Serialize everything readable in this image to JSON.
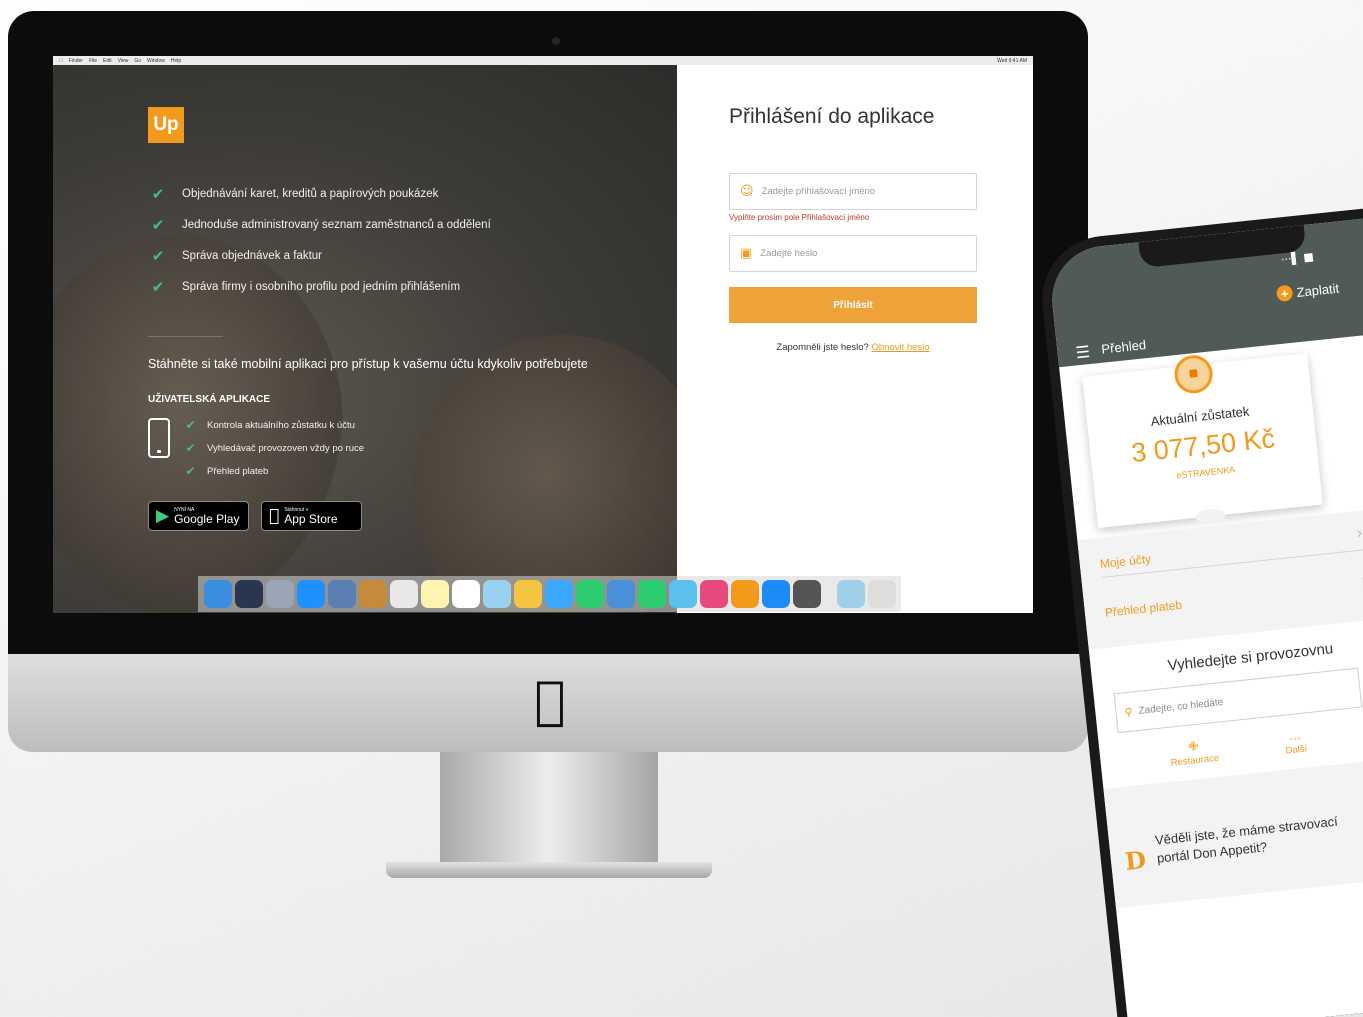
{
  "menubar": {
    "items": [
      "Finder",
      "File",
      "Edit",
      "View",
      "Go",
      "Window",
      "Help"
    ],
    "clock": "Wed 9:41 AM"
  },
  "brand": {
    "logo": "Up",
    "accent": "#f39a1c",
    "check_color": "#3dbd9a"
  },
  "features": [
    "Objednávání karet, kreditů a papírových poukázek",
    "Jednoduše administrovaný seznam zaměstnanců a oddělení",
    "Správa objednávek a faktur",
    "Správa firmy i osobního profilu pod jedním přihlášením"
  ],
  "mobile": {
    "title": "Stáhněte si také mobilní aplikaci pro přístup k vašemu účtu kdykoliv potřebujete",
    "app_label": "UŽIVATELSKÁ APLIKACE",
    "features": [
      "Kontrola aktuálního zůstatku k účtu",
      "Vyhledávač provozoven vždy po ruce",
      "Přehled plateb"
    ],
    "google": {
      "small": "NYNÍ NA",
      "big": "Google Play",
      "icon": "play-icon"
    },
    "apple": {
      "small": "Stáhnout v",
      "big": "App Store",
      "icon": "apple-icon"
    }
  },
  "login": {
    "title": "Přihlášení do aplikace",
    "username_placeholder": "Zadejte přihlašovací jméno",
    "username_error": "Vyplňte prosím pole Přihlašovací jméno",
    "password_placeholder": "Zadejte heslo",
    "submit": "Přihlásit",
    "forgot_text": "Zapomněli jste heslo?",
    "forgot_link": "Obnovit heslo"
  },
  "dock": {
    "colors": [
      "#3b8de0",
      "#2a3550",
      "#9aa5b5",
      "#1e90ff",
      "#5a7fb0",
      "#c68a3c",
      "#e8e8e8",
      "#fff3b0",
      "#ffffff",
      "#9ad0f0",
      "#f4c542",
      "#3ba7ff",
      "#2ecc71",
      "#4a90d9",
      "#2ecc71",
      "#5bc0eb",
      "#e84a7f",
      "#f39a1c",
      "#1d8cf8",
      "#555555",
      "#9fd0ea",
      "#dddddd"
    ]
  },
  "phone": {
    "status": "···▌ ■",
    "pay": "Zaplatit",
    "title": "Přehled",
    "balance_label": "Aktuální zůstatek",
    "balance_value": "3 077,50 Kč",
    "balance_sub": "eSTRAVENKA",
    "links": [
      "Moje účty",
      "Přehled plateb"
    ],
    "search_title": "Vyhledejte si provozovnu",
    "search_placeholder": "Zadejte, co hledáte",
    "categories": [
      {
        "icon": "fork-knife-icon",
        "glyph": "✙",
        "label": "Restaurace"
      },
      {
        "icon": "more-icon",
        "glyph": "…",
        "label": "Další"
      }
    ],
    "promo": "Věděli jste, že máme stravovací portál Don Appetit?"
  }
}
